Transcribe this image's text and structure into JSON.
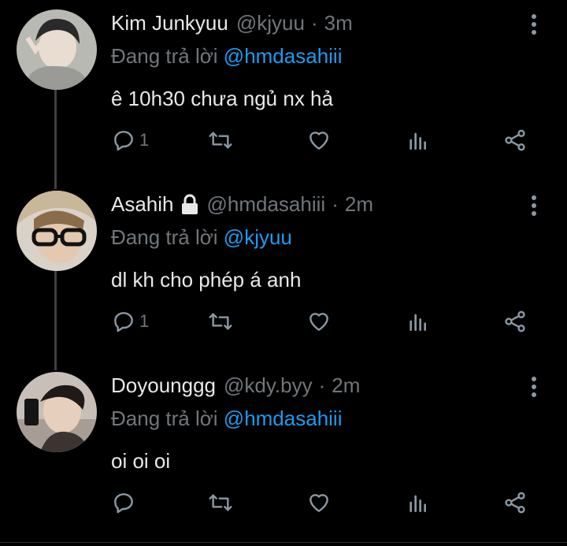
{
  "tweets": [
    {
      "name": "Kim Junkyuu",
      "handle": "@kjyuu",
      "separator": "·",
      "time": "3m",
      "reply_prefix": "Đang trả lời",
      "reply_to": "@hmdasahiii",
      "text": "ê 10h30 chưa ngủ nx hả",
      "reply_count": "1",
      "locked": false
    },
    {
      "name": "Asahih",
      "handle": "@hmdasahiii",
      "separator": "·",
      "time": "2m",
      "reply_prefix": "Đang trả lời",
      "reply_to": "@kjyuu",
      "text": "dl kh cho phép á anh",
      "reply_count": "1",
      "locked": true
    },
    {
      "name": "Doyounggg",
      "handle": "@kdy.byy",
      "separator": "·",
      "time": "2m",
      "reply_prefix": "Đang trả lời",
      "reply_to": "@hmdasahiii",
      "text": "oi oi oi",
      "reply_count": "",
      "locked": false
    }
  ],
  "icons": {
    "reply": "reply-icon",
    "retweet": "retweet-icon",
    "like": "heart-icon",
    "views": "views-icon",
    "share": "share-icon",
    "more": "more-vertical-icon",
    "lock": "lock-icon"
  },
  "colors": {
    "background": "#000000",
    "text": "#e7e9ea",
    "muted": "#71767b",
    "link": "#1d9bf0",
    "thread_line": "#3e4144"
  }
}
